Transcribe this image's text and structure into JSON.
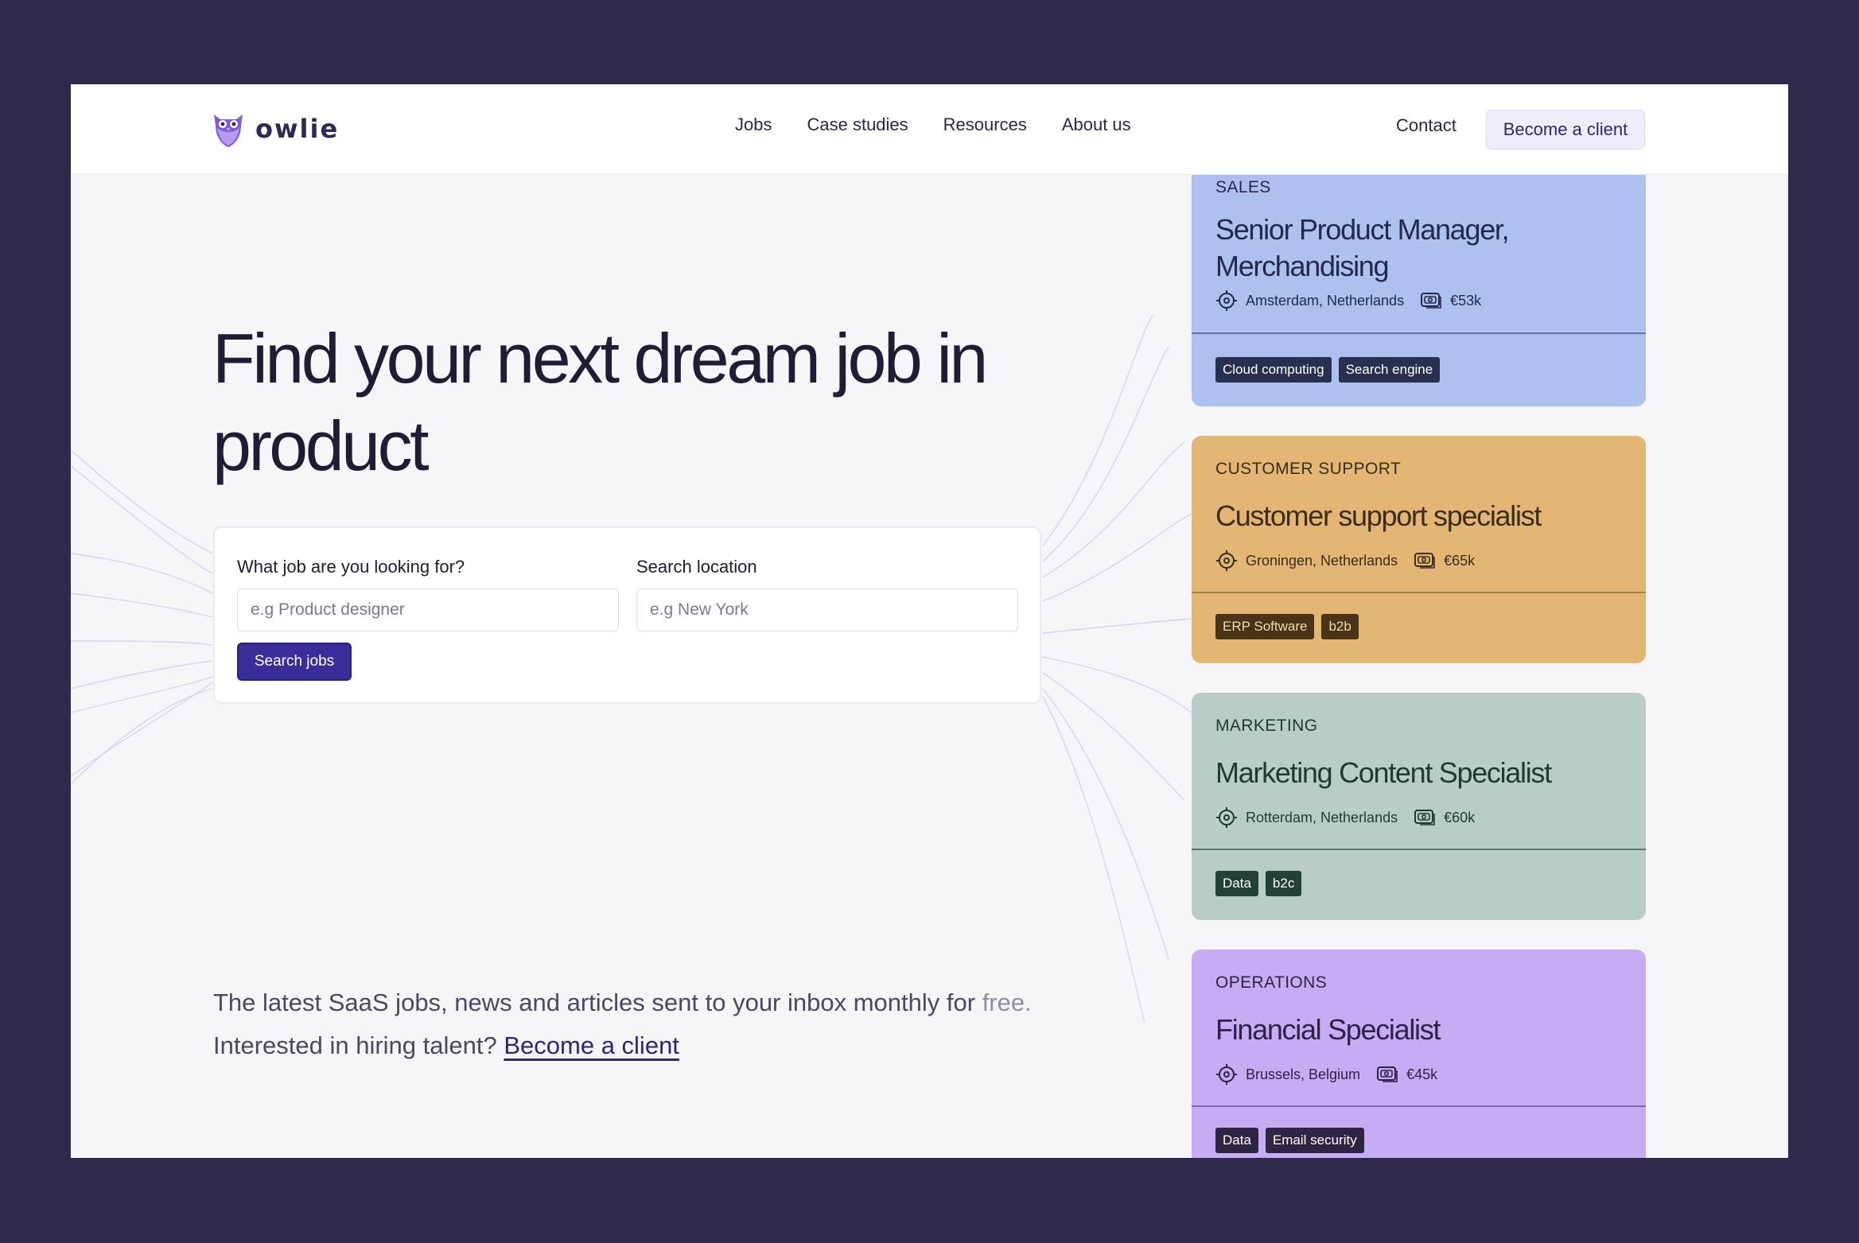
{
  "brand": {
    "name": "owlie"
  },
  "nav": {
    "items": [
      "Jobs",
      "Case studies",
      "Resources",
      "About us"
    ],
    "contact": "Contact",
    "cta": "Become a client"
  },
  "hero": {
    "title_line1": "Find your next dream job in",
    "title_line2": "product"
  },
  "search": {
    "job_label": "What job are you looking for?",
    "job_placeholder": "e.g Product designer",
    "location_label": "Search location",
    "location_placeholder": "e.g New York",
    "button": "Search jobs"
  },
  "newsletter": {
    "text": "The latest SaaS jobs, news and articles sent to your inbox monthly for",
    "free": "free.",
    "hiring_text": "Interested in hiring talent?",
    "hiring_link": "Become a client"
  },
  "jobs": [
    {
      "category": "SALES",
      "title_line1": "Senior Product Manager,",
      "title_line2": "Merchandising",
      "location": "Amsterdam, Netherlands",
      "salary": "€53k",
      "tags": [
        "Cloud computing",
        "Search engine"
      ],
      "colors": {
        "bg": "#aec1ee",
        "text": "#23284d",
        "divider": "#5f74ad",
        "tag": "#27304f"
      }
    },
    {
      "category": "CUSTOMER SUPPORT",
      "title_line1": "Customer support specialist",
      "location": "Groningen, Netherlands",
      "salary": "€65k",
      "tags": [
        "ERP Software",
        "b2b"
      ],
      "colors": {
        "bg": "#e3b673",
        "text": "#3a2d1a",
        "divider": "#a27f43",
        "tag": "#4a3417"
      }
    },
    {
      "category": "MARKETING",
      "title_line1": "Marketing Content Specialist",
      "location": "Rotterdam, Netherlands",
      "salary": "€60k",
      "tags": [
        "Data",
        "b2c"
      ],
      "colors": {
        "bg": "#b8cdc8",
        "text": "#1f3a33",
        "divider": "#557a70",
        "tag": "#234138"
      }
    },
    {
      "category": "OPERATIONS",
      "title_line1": "Financial Specialist",
      "location": "Brussels, Belgium",
      "salary": "€45k",
      "tags": [
        "Data",
        "Email security"
      ],
      "colors": {
        "bg": "#c5acf3",
        "text": "#2d2248",
        "divider": "#7d64b0",
        "tag": "#2e2443"
      }
    }
  ],
  "icons": {
    "location": "location-target-icon",
    "salary": "banknote-icon",
    "logo": "owl-logo-icon"
  }
}
